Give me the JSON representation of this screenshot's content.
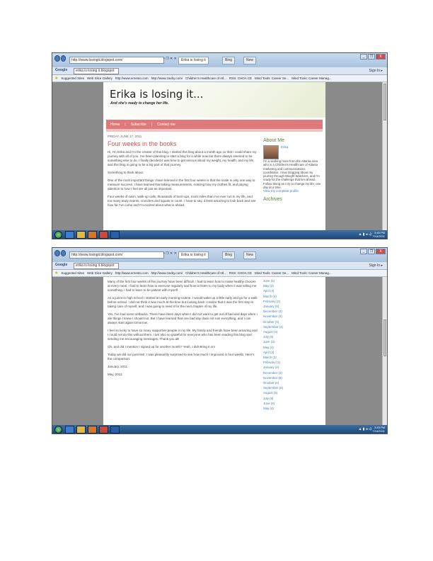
{
  "browser": {
    "url": "http://www.losingit.blogspot.com/",
    "tab_active": "Erika is losing it",
    "tab_other": "Bing",
    "new_tab": "New",
    "address_controls": "• ❐ ✕ ✕",
    "search_brand": "Google",
    "search_value": "erika is losing it.blogspot",
    "sign_in": "Sign In ▸",
    "window_buttons": [
      "_",
      "❐",
      "X"
    ]
  },
  "favorites": [
    "Suggested Sites",
    "Web Slice Gallery",
    "http://www.ernesto.com",
    "http://www.zaxby.com/",
    "Children's Healthcare of Atl...",
    "RSS: CHOA CE",
    "Mind Tools: Career Se...",
    "Mind Tools: Career Manag..."
  ],
  "taskbar": {
    "time": "3:45 PM",
    "date": "7/14/2011",
    "tray": "▲ ▮ ◂ ◃)"
  },
  "blog": {
    "title": "Erika is losing it...",
    "description": "And she's ready to change her life.",
    "menu": [
      "Home",
      "Subscribe",
      "Contact me"
    ],
    "post_date": "FRIDAY, JUNE 17, 2011",
    "post_title": "Four weeks in the books",
    "paragraphs_top": [
      "Hi, I'm Erika and I'm the creator of this blog. I started this blog about a month ago so that I could share my journey with all of you. I've been planning to start a blog for a while now but there always seemed to be something else to do. I finally decided it was time to get serious about my weight, my health, and my life, and this blog is going to be a big part of that journey.",
      "Something to think about.",
      "One of the most important things I have learned in the first four weeks is that the scale is only one way to measure success. I have learned that taking measurements, noticing how my clothes fit, and paying attention to how I feel are all just as important.",
      "Four weeks of swim, walk-up calls, thousands of burn-ups, more miles than I've ever run in my life, and too many teary events, crunches and squats to count. I have to say, it feels amazing to look back and see how far I've come and I'm excited about what is ahead."
    ],
    "paragraphs_bottom": [
      "Many of the first four weeks of this journey have been difficult. I had to learn how to make healthy choices at every meal. I had to learn how to exercise regularly and how to listen to my body when it was telling me something. I had to learn to be patient with myself.",
      "As a junior in high school I started an early morning routine. I would wake up a little early and go for a walk before school. I did not think it was much at the time but looking back I realize that it was the first step in taking care of myself, and I was going to need it for the next chapter of my life.",
      "Yes, I've had some setbacks. There have been days when I did not want to get out of bed and days when I ate things I knew I should not. But I have learned that one bad day does not ruin everything, and I can always start again tomorrow.",
      "I feel so lucky to have so many supportive people in my life. My family and friends have been amazing and I could not do this without them. I am also so grateful for everyone who has been reading this blog and sending me encouraging messages. Thank you all!",
      "Oh, and did I mention I signed up for another month? Yeah, I did! Bring it on!",
      "Today we did our post-test. I was pleasantly surprised to see how much I improved in four weeks. Here's the comparison:",
      "January, 2011:",
      "May, 2011:"
    ],
    "sidebar_about_heading": "About Me",
    "about_name": "Erika",
    "about_text": "I'm a working mom from the Atlanta area who is a Children's Healthcare of Atlanta marketing and communications coordinator. I love blogging about my journey through Weight Watchers, and I'm ready for the challenge that lies ahead. Follow along as I try to change my life, one day at a time.",
    "view_profile": "View my complete profile",
    "archive_heading": "Archives",
    "archive": [
      "June (1)",
      "May (3)",
      "April (4)",
      "March (4)",
      "February (2)",
      "January (6)",
      "December (4)",
      "November (4)",
      "October (4)",
      "September (4)",
      "August (4)",
      "July (5)",
      "June (3)",
      "May (4)",
      "April (4)",
      "March (3)",
      "February (1)",
      "January (4)",
      "December (4)",
      "November (5)",
      "October (4)",
      "September (5)",
      "August (5)",
      "July (6)",
      "June (4)",
      "May (4)"
    ]
  }
}
